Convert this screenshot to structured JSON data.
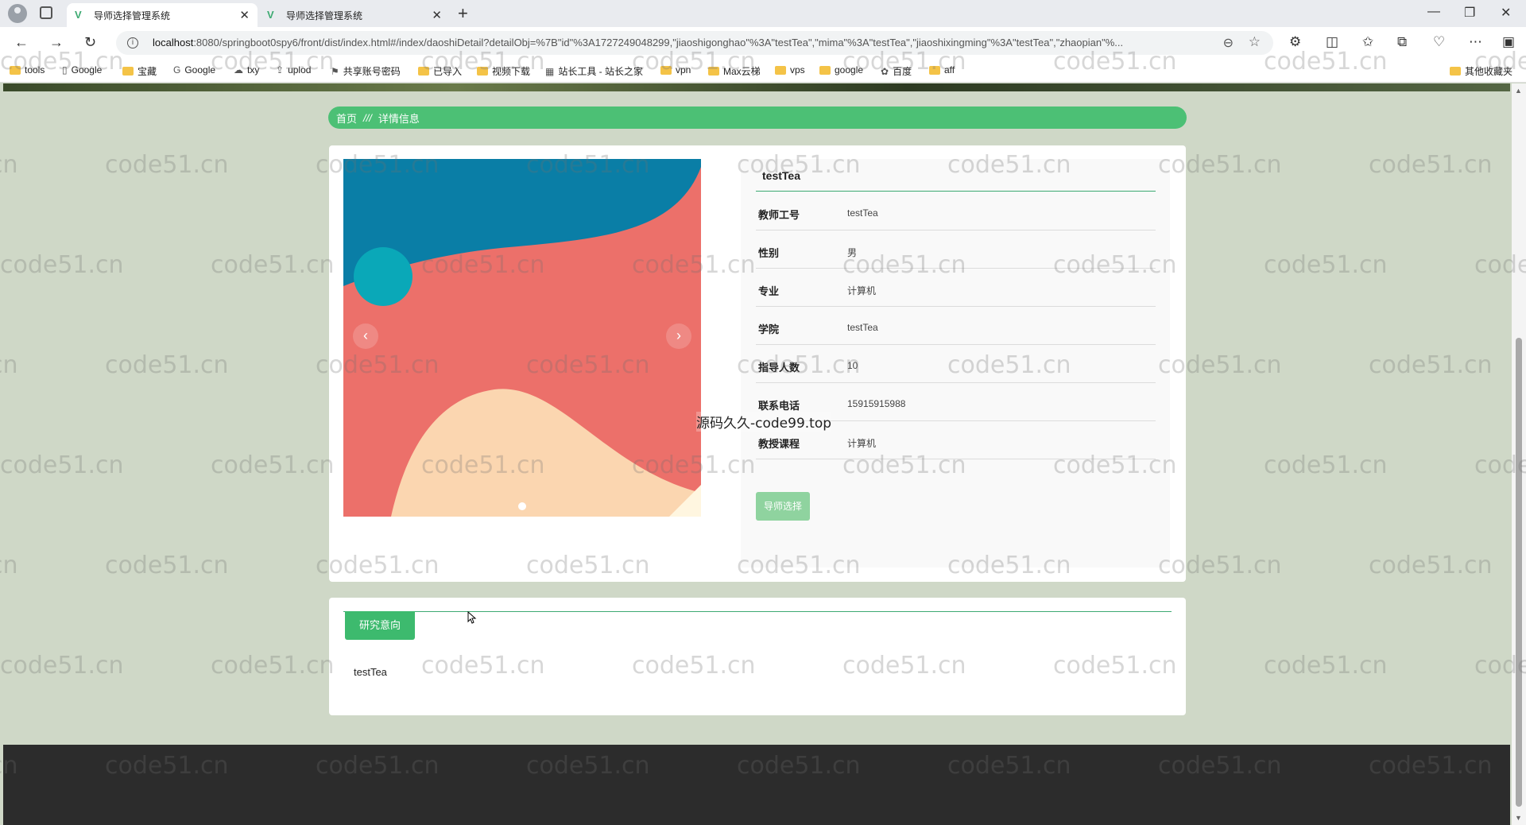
{
  "browser": {
    "tabs": [
      {
        "title": "导师选择管理系统",
        "active": true
      },
      {
        "title": "导师选择管理系统",
        "active": false
      }
    ],
    "url_host": "localhost",
    "url_rest": ":8080/springboot0spy6/front/dist/index.html#/index/daoshiDetail?detailObj=%7B\"id\"%3A1727249048299,\"jiaoshigonghao\"%3A\"testTea\",\"mima\"%3A\"testTea\",\"jiaoshixingming\"%3A\"testTea\",\"zhaopian\"%...",
    "bookmarks": [
      {
        "label": "tools",
        "icon": "folder-icon"
      },
      {
        "label": "Google",
        "icon": "page-icon"
      },
      {
        "label": "宝藏",
        "icon": "folder-icon"
      },
      {
        "label": "Google",
        "icon": "google-icon"
      },
      {
        "label": "txy",
        "icon": "cloud-icon"
      },
      {
        "label": "uplod",
        "icon": "upload-icon"
      },
      {
        "label": "共享账号密码",
        "icon": "share-icon"
      },
      {
        "label": "已导入",
        "icon": "folder-icon"
      },
      {
        "label": "视频下载",
        "icon": "folder-icon"
      },
      {
        "label": "站长工具 - 站长之家",
        "icon": "site-icon"
      },
      {
        "label": "vpn",
        "icon": "folder-icon"
      },
      {
        "label": "Max云梯",
        "icon": "folder-icon"
      },
      {
        "label": "vps",
        "icon": "folder-icon"
      },
      {
        "label": "google",
        "icon": "folder-icon"
      },
      {
        "label": "百度",
        "icon": "baidu-icon"
      },
      {
        "label": "aff",
        "icon": "folder-icon"
      }
    ],
    "other_bookmarks": "其他收藏夹"
  },
  "breadcrumb": {
    "home": "首页",
    "separator": "///",
    "current": "详情信息"
  },
  "teacher": {
    "name": "testTea",
    "fields": [
      {
        "label": "教师工号",
        "value": "testTea"
      },
      {
        "label": "性别",
        "value": "男"
      },
      {
        "label": "专业",
        "value": "计算机"
      },
      {
        "label": "学院",
        "value": "testTea"
      },
      {
        "label": "指导人数",
        "value": "10"
      },
      {
        "label": "联系电话",
        "value": "15915915988"
      },
      {
        "label": "教授课程",
        "value": "计算机"
      }
    ],
    "select_button": "导师选择"
  },
  "research": {
    "tab_label": "研究意向",
    "content": "testTea"
  },
  "watermark": "code51.cn",
  "overlay_text": "源码久久-code99.top",
  "colors": {
    "accent": "#4cc075",
    "button_light": "#8fd39f",
    "footer": "#2c2c2c"
  }
}
